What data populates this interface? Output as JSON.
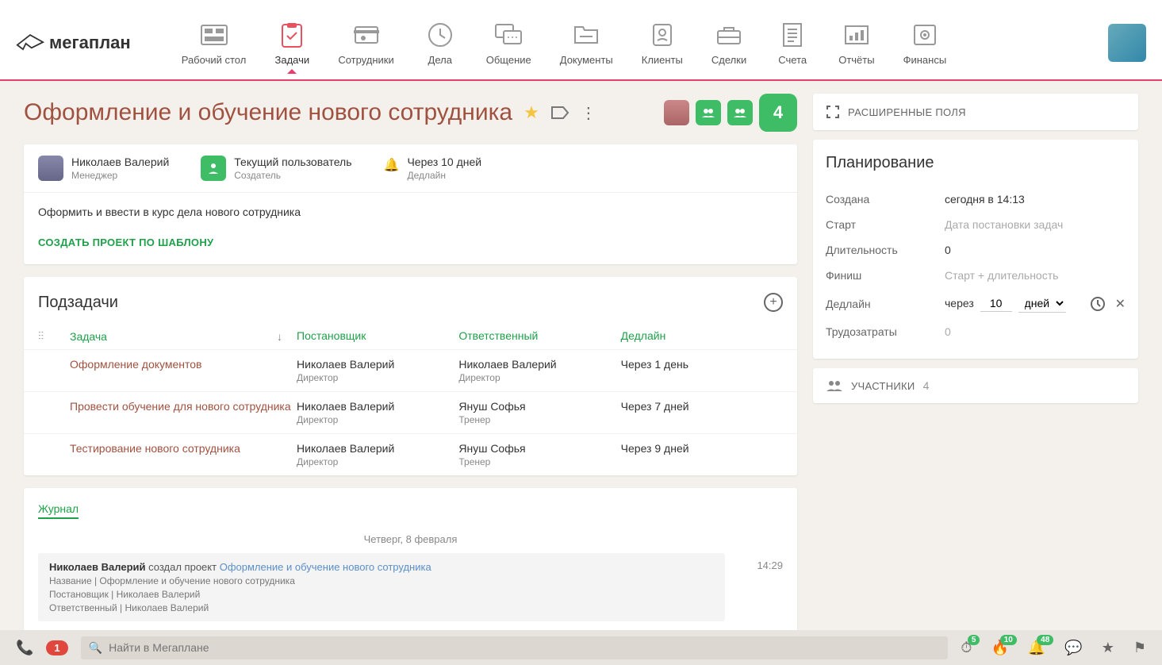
{
  "logo_text": "мегаплан",
  "nav": [
    {
      "label": "Рабочий стол"
    },
    {
      "label": "Задачи"
    },
    {
      "label": "Сотрудники"
    },
    {
      "label": "Дела"
    },
    {
      "label": "Общение"
    },
    {
      "label": "Документы"
    },
    {
      "label": "Клиенты"
    },
    {
      "label": "Сделки"
    },
    {
      "label": "Счета"
    },
    {
      "label": "Отчёты"
    },
    {
      "label": "Финансы"
    }
  ],
  "page_title": "Оформление и обучение нового сотрудника",
  "group_count": "4",
  "meta": {
    "manager_name": "Николаев Валерий",
    "manager_role": "Менеджер",
    "creator_name": "Текущий пользователь",
    "creator_role": "Создатель",
    "deadline_text": "Через 10 дней",
    "deadline_label": "Дедлайн"
  },
  "description": "Оформить и ввести в курс дела нового сотрудника",
  "create_template_link": "СОЗДАТЬ ПРОЕКТ ПО ШАБЛОНУ",
  "subtasks": {
    "title": "Подзадачи",
    "columns": {
      "task": "Задача",
      "owner": "Постановщик",
      "responsible": "Ответственный",
      "deadline": "Дедлайн"
    },
    "rows": [
      {
        "task": "Оформление документов",
        "owner_name": "Николаев Валерий",
        "owner_role": "Директор",
        "resp_name": "Николаев Валерий",
        "resp_role": "Директор",
        "deadline": "Через 1 день"
      },
      {
        "task": "Провести обучение для нового сотрудника",
        "owner_name": "Николаев Валерий",
        "owner_role": "Директор",
        "resp_name": "Януш Софья",
        "resp_role": "Тренер",
        "deadline": "Через 7 дней"
      },
      {
        "task": "Тестирование нового сотрудника",
        "owner_name": "Николаев Валерий",
        "owner_role": "Директор",
        "resp_name": "Януш Софья",
        "resp_role": "Тренер",
        "deadline": "Через 9 дней"
      }
    ]
  },
  "journal": {
    "tab": "Журнал",
    "date": "Четверг, 8 февраля",
    "entry": {
      "author": "Николаев Валерий",
      "action": "создал проект",
      "project": "Оформление и обучение нового сотрудника",
      "details": [
        {
          "label": "Название",
          "value": "Оформление и обучение нового сотрудника"
        },
        {
          "label": "Постановщик",
          "value": "Николаев Валерий"
        },
        {
          "label": "Ответственный",
          "value": "Николаев Валерий"
        }
      ],
      "time": "14:29"
    }
  },
  "side": {
    "extended_fields": "РАСШИРЕННЫЕ ПОЛЯ",
    "planning": {
      "title": "Планирование",
      "rows": {
        "created_label": "Создана",
        "created_value": "сегодня в 14:13",
        "start_label": "Старт",
        "start_value": "Дата постановки задач",
        "duration_label": "Длительность",
        "duration_value": "0",
        "finish_label": "Финиш",
        "finish_value": "Старт + длительность",
        "deadline_label": "Дедлайн",
        "deadline_prefix": "через",
        "deadline_value": "10",
        "deadline_unit": "дней",
        "labor_label": "Трудозатраты",
        "labor_value": "0"
      }
    },
    "participants_label": "УЧАСТНИКИ",
    "participants_count": "4"
  },
  "bottombar": {
    "call_badge": "1",
    "search_placeholder": "Найти в Мегаплане",
    "badges": {
      "timer": "5",
      "fire": "10",
      "bell": "48"
    }
  }
}
